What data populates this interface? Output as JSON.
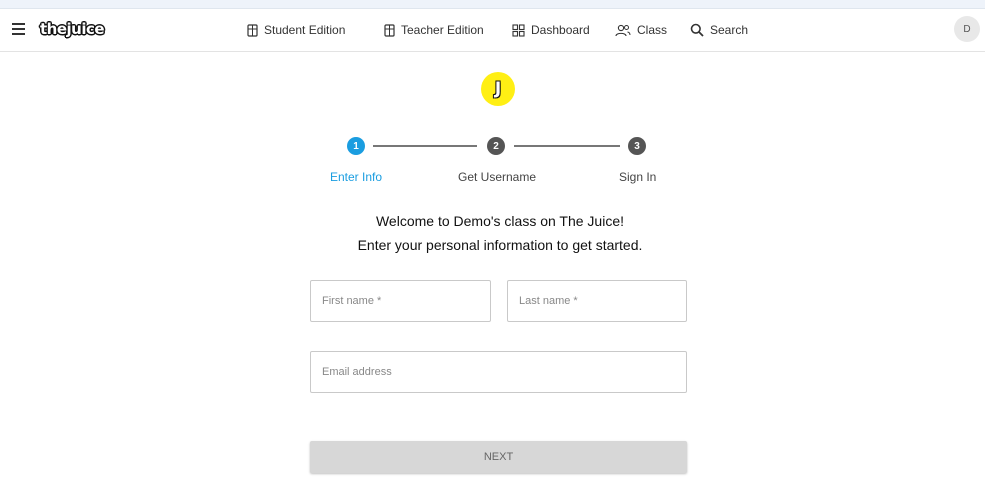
{
  "header": {
    "logo_text": "thejuice",
    "nav": [
      {
        "label": "Student Edition",
        "icon": "book-icon"
      },
      {
        "label": "Teacher Edition",
        "icon": "book-icon"
      },
      {
        "label": "Dashboard",
        "icon": "grid-icon"
      },
      {
        "label": "Class",
        "icon": "users-icon"
      },
      {
        "label": "Search",
        "icon": "search-icon"
      }
    ],
    "avatar_initial": "D"
  },
  "brand_badge": "J",
  "stepper": {
    "active_color": "#1a9de0",
    "inactive_color": "#555555",
    "steps": [
      {
        "number": "1",
        "label": "Enter Info",
        "active": true
      },
      {
        "number": "2",
        "label": "Get Username",
        "active": false
      },
      {
        "number": "3",
        "label": "Sign In",
        "active": false
      }
    ]
  },
  "welcome": {
    "line1": "Welcome to Demo's class on The Juice!",
    "line2": "Enter your personal information to get started."
  },
  "form": {
    "first_name_placeholder": "First name *",
    "last_name_placeholder": "Last name *",
    "email_placeholder": "Email address",
    "next_label": "NEXT"
  }
}
